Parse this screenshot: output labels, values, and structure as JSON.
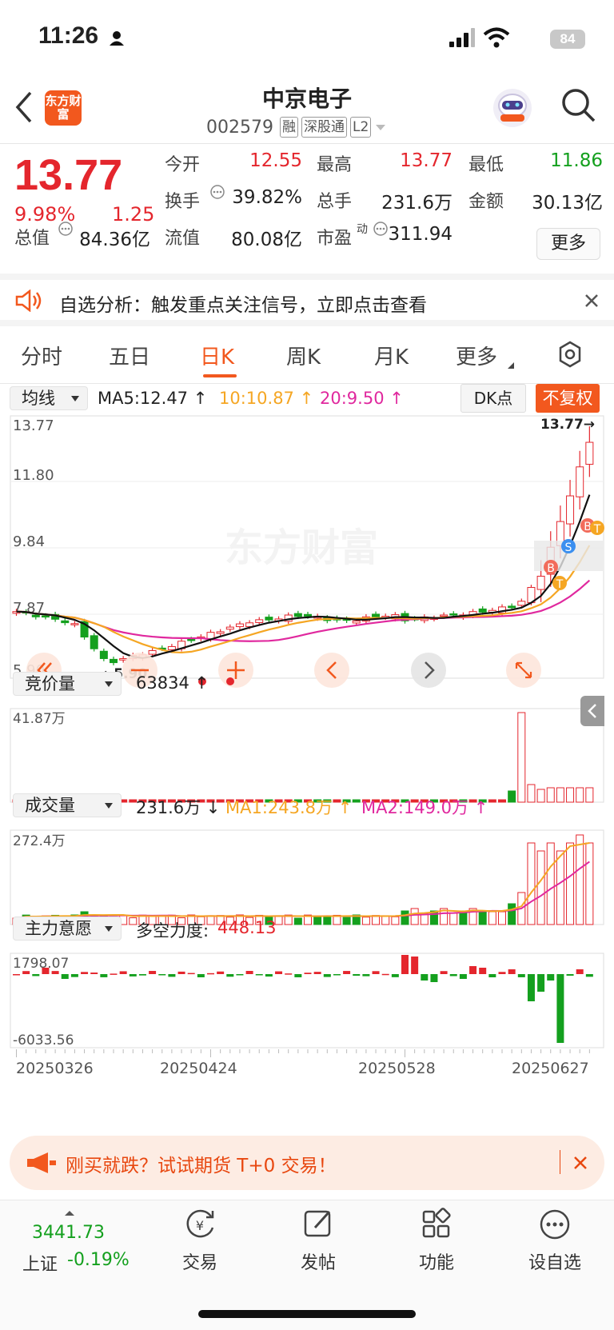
{
  "status_bar": {
    "time": "11:26",
    "battery": "84"
  },
  "header": {
    "logo_text": "东方财富",
    "stock_name": "中京电子",
    "stock_code": "002579",
    "tags": [
      "融",
      "深股通",
      "L2"
    ]
  },
  "quote": {
    "price": "13.77",
    "change_pct": "9.98%",
    "change": "1.25",
    "open_label": "今开",
    "open": "12.55",
    "high_label": "最高",
    "high": "13.77",
    "low_label": "最低",
    "low": "11.86",
    "turnover_label": "换手",
    "turnover": "39.82%",
    "volume_label": "总手",
    "volume": "231.6万",
    "amount_label": "金额",
    "amount": "30.13亿",
    "mktcap_label": "总值",
    "mktcap": "84.36亿",
    "float_label": "流值",
    "float": "80.08亿",
    "pe_label": "市盈",
    "pe_sup": "动",
    "pe": "311.94",
    "more": "更多"
  },
  "alert": {
    "text": "自选分析：触发重点关注信号，立即点击查看"
  },
  "tabs": [
    {
      "label": "分时"
    },
    {
      "label": "五日"
    },
    {
      "label": "日K"
    },
    {
      "label": "周K"
    },
    {
      "label": "月K"
    },
    {
      "label": "更多"
    }
  ],
  "active_tab": "日K",
  "chart": {
    "indicator_select": "均线",
    "ma5": "MA5:12.47",
    "ma10": "10:10.87",
    "ma20": "20:9.50",
    "dk_button": "DK点",
    "fuquan_button": "不复权",
    "price_axis": [
      "13.77",
      "11.80",
      "9.84",
      "7.87",
      "5.90"
    ],
    "max_marker": "13.77",
    "min_marker": "5.90",
    "watermark": "东方财富",
    "bs_marks": [
      "B",
      "S",
      "B",
      "T",
      "T"
    ],
    "auction_select": "竞价量",
    "auction_value": "63834",
    "auction_axis_top": "41.87万",
    "volume_select": "成交量",
    "volume_value": "231.6万",
    "vol_ma1": "MA1:243.8万",
    "vol_ma2": "MA2:149.0万",
    "volume_axis_top": "272.4万",
    "main_select": "主力意愿",
    "main_label": "多空力度:",
    "main_value": "448.13",
    "main_axis_top": "1798.07",
    "main_axis_bottom": "-6033.56",
    "dates": [
      "20250326",
      "20250424",
      "20250528",
      "20250627"
    ],
    "colors": {
      "up": "#e4262d",
      "down": "#14a01e",
      "ma5": "#111111",
      "ma10": "#f5a623",
      "ma20": "#e0289e",
      "accent": "#f2581e"
    }
  },
  "promo": {
    "text": "刚买就跌？试试期货 T+0 交易！"
  },
  "bottom_nav": {
    "index_value": "3441.73",
    "index_name": "上证",
    "index_pct": "-0.19%",
    "items": [
      {
        "label": "交易"
      },
      {
        "label": "发帖"
      },
      {
        "label": "功能"
      },
      {
        "label": "设自选"
      }
    ]
  }
}
